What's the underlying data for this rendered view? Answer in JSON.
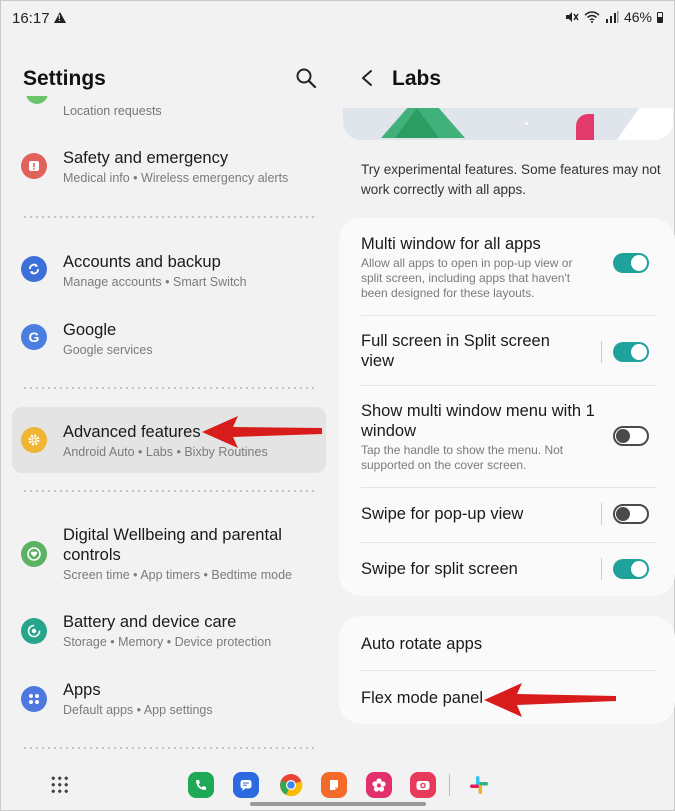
{
  "status_bar": {
    "time": "16:17",
    "battery": "46%"
  },
  "settings": {
    "title": "Settings",
    "location_sub": "Location requests",
    "items": [
      {
        "title": "Safety and emergency",
        "sub": "Medical info  •  Wireless emergency alerts",
        "icon": "alert-icon",
        "color": "#e0625a"
      },
      {
        "title": "Accounts and backup",
        "sub": "Manage accounts  •  Smart Switch",
        "icon": "sync-icon",
        "color": "#3d6fd8"
      },
      {
        "title": "Google",
        "sub": "Google services",
        "icon": "google-icon",
        "color": "#4a7fe0"
      },
      {
        "title": "Advanced features",
        "sub": "Android Auto  •  Labs  •  Bixby Routines",
        "icon": "gear-plus-icon",
        "color": "#f1b534"
      },
      {
        "title": "Digital Wellbeing and parental controls",
        "sub": "Screen time  •  App timers  •  Bedtime mode",
        "icon": "heart-icon",
        "color": "#5bb260"
      },
      {
        "title": "Battery and device care",
        "sub": "Storage  •  Memory  •  Device protection",
        "icon": "device-care-icon",
        "color": "#27a58c"
      },
      {
        "title": "Apps",
        "sub": "Default apps  •  App settings",
        "icon": "apps-icon",
        "color": "#4c78e0"
      }
    ]
  },
  "labs": {
    "title": "Labs",
    "intro": "Try experimental features. Some features may not work correctly with all apps.",
    "toggles": [
      {
        "title": "Multi window for all apps",
        "desc": "Allow all apps to open in pop-up view or split screen, including apps that haven't been designed for these layouts.",
        "on": true
      },
      {
        "title": "Full screen in Split screen view",
        "desc": "",
        "on": true
      },
      {
        "title": "Show multi window menu with 1 window",
        "desc": "Tap the handle to show the menu. Not supported on the cover screen.",
        "on": false
      },
      {
        "title": "Swipe for pop-up view",
        "desc": "",
        "on": false
      },
      {
        "title": "Swipe for split screen",
        "desc": "",
        "on": true
      }
    ],
    "links": [
      {
        "title": "Auto rotate apps"
      },
      {
        "title": "Flex mode panel"
      }
    ]
  },
  "dock": {
    "apps": [
      {
        "name": "phone",
        "color": "#1fa855",
        "glyph": "✆"
      },
      {
        "name": "messages",
        "color": "#2d6ae0",
        "glyph": "≡"
      },
      {
        "name": "chrome",
        "color": "#ffffff",
        "glyph": ""
      },
      {
        "name": "notes",
        "color": "#f36a2b",
        "glyph": "▤"
      },
      {
        "name": "flower",
        "color": "#e2316a",
        "glyph": "✿"
      },
      {
        "name": "camera",
        "color": "#e83a5a",
        "glyph": "◉"
      },
      {
        "name": "slack",
        "color": "#ffffff",
        "glyph": "#"
      }
    ]
  },
  "annotation_color": "#d81b1b"
}
